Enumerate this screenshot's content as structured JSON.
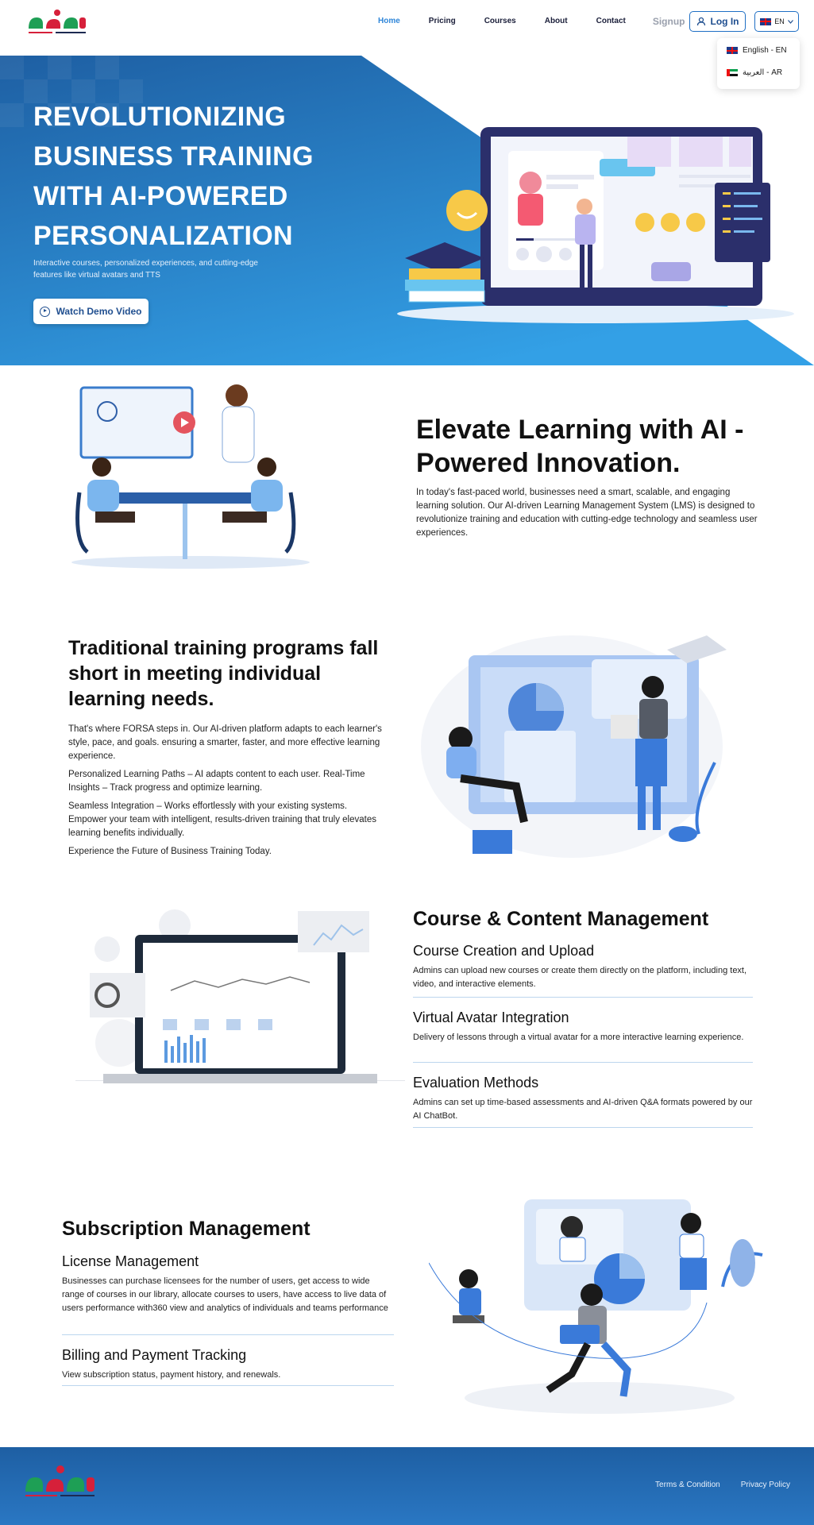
{
  "header": {
    "nav": [
      {
        "label": "Home",
        "active": true
      },
      {
        "label": "Pricing"
      },
      {
        "label": "Courses"
      },
      {
        "label": "About"
      },
      {
        "label": "Contact"
      }
    ],
    "signup_label": "Signup",
    "login_label": "Log In",
    "lang_label": "EN",
    "lang_options": [
      "English - EN",
      "العربية - AR"
    ]
  },
  "hero": {
    "title": "REVOLUTIONIZING BUSINESS TRAINING WITH AI-POWERED PERSONALIZATION",
    "subtitle": "Interactive courses, personalized experiences, and cutting-edge features like virtual avatars and TTS",
    "cta_label": "Watch Demo Video"
  },
  "elevate": {
    "title": "Elevate Learning with AI -Powered Innovation.",
    "body": "In today's fast-paced world, businesses need a smart, scalable, and engaging learning solution. Our AI-driven Learning Management System (LMS) is designed to revolutionize training and education with cutting-edge technology and seamless user experiences."
  },
  "traditional": {
    "title": "Traditional training programs fall short in meeting individual learning needs.",
    "paragraphs": [
      "That's where FORSA steps in. Our AI-driven platform adapts to each learner's style, pace, and goals. ensuring a smarter, faster, and more effective learning experience.",
      "Personalized Learning Paths – AI adapts content to each user. Real-Time Insights – Track progress and optimize learning.",
      "Seamless Integration – Works effortlessly with your existing systems. Empower your team with intelligent, results-driven training that truly elevates learning benefits individually.",
      "Experience the Future of Business Training Today."
    ]
  },
  "course_mgmt": {
    "title": "Course & Content Management",
    "features": [
      {
        "title": "Course Creation and Upload",
        "desc": "Admins can upload new courses or create them directly on the platform, including text, video, and interactive elements."
      },
      {
        "title": "Virtual Avatar Integration",
        "desc": "Delivery of lessons through a virtual avatar for a more interactive learning experience."
      },
      {
        "title": "Evaluation Methods",
        "desc": "Admins can set up time-based assessments and AI-driven Q&A formats powered by our AI ChatBot."
      }
    ]
  },
  "subscription": {
    "title": "Subscription Management",
    "features": [
      {
        "title": "License Management",
        "desc": "Businesses can purchase licensees for the number of users, get access to wide range of courses in our library, allocate courses to users, have access to live data of users performance with360 view and analytics of individuals and teams performance"
      },
      {
        "title": "Billing and Payment Tracking",
        "desc": "View subscription status, payment history, and renewals."
      }
    ]
  },
  "footer": {
    "links": [
      "Terms & Condition",
      "Privacy Policy"
    ]
  },
  "colors": {
    "brand_blue": "#1f6fc4",
    "hero_blue": "#2b8ad6",
    "active_nav": "#2f86d9",
    "logo_red": "#d6203a",
    "logo_green": "#1e9f55"
  }
}
